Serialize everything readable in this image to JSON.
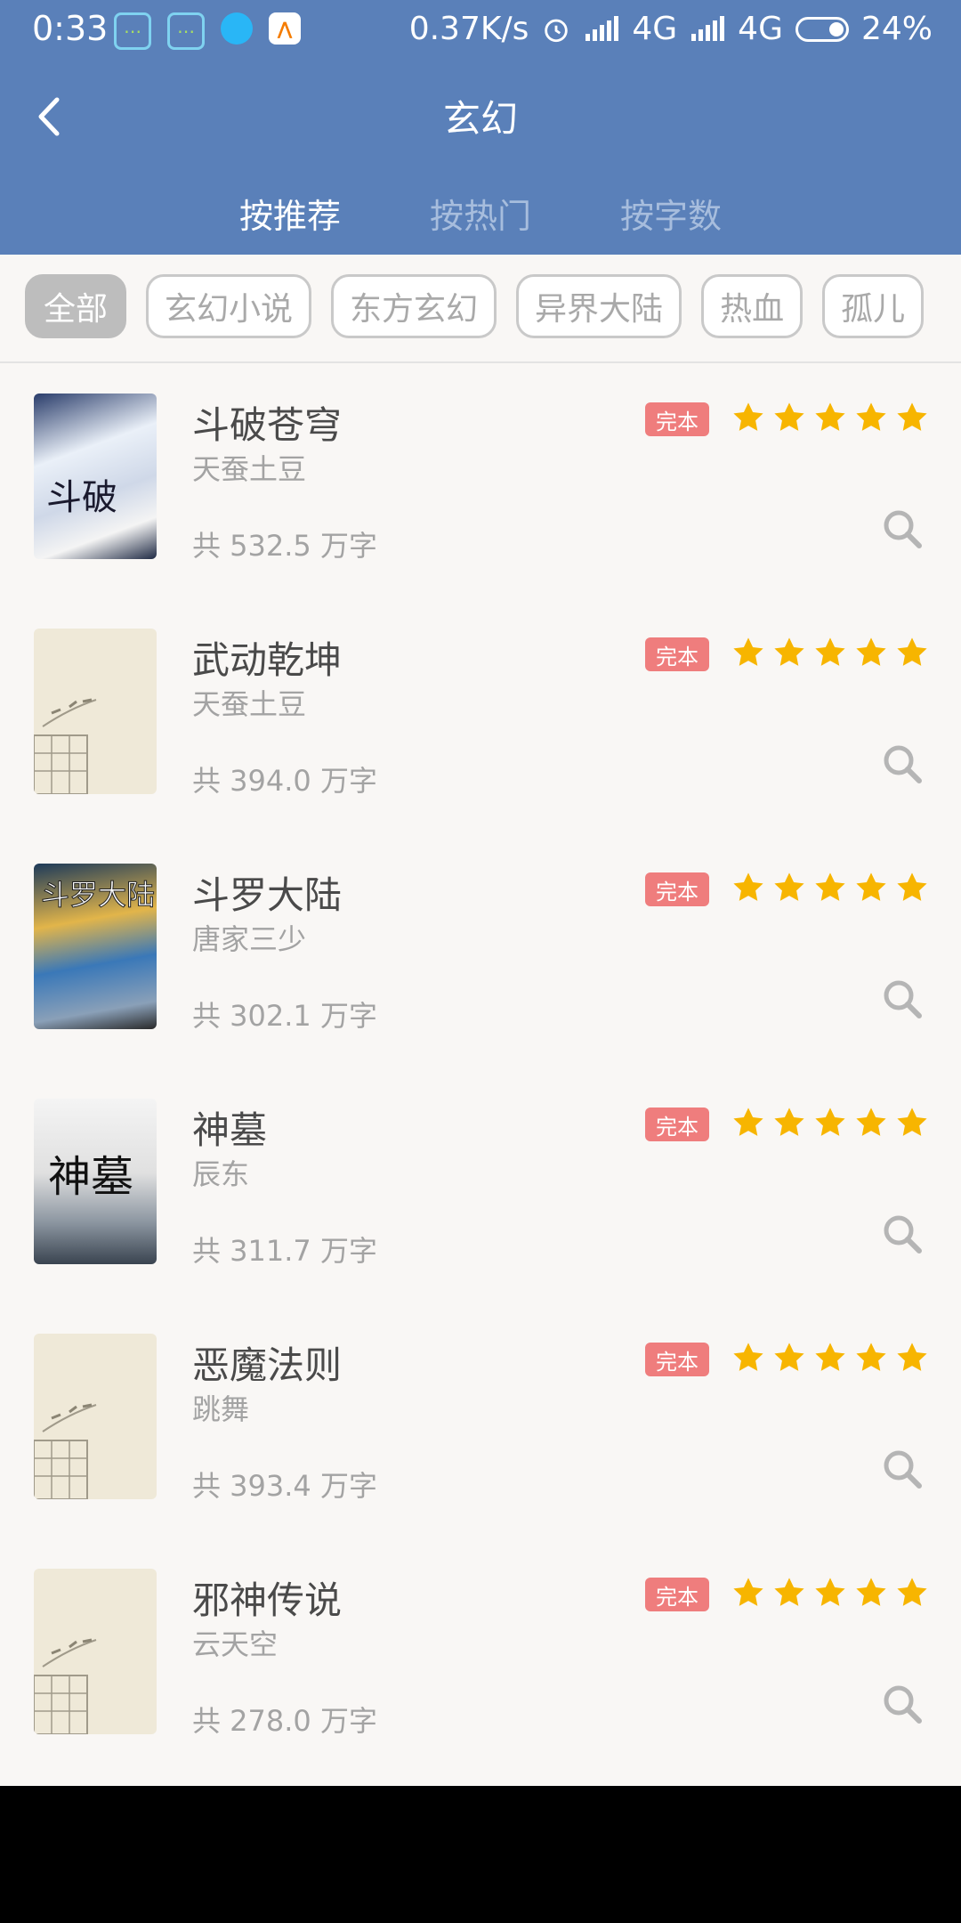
{
  "status_bar": {
    "time": "0:33",
    "network_speed": "0.37K/s",
    "signal_1": "4G",
    "signal_2": "4G",
    "battery": "24%"
  },
  "header": {
    "title": "玄幻",
    "tabs": [
      {
        "label": "按推荐",
        "active": true
      },
      {
        "label": "按热门",
        "active": false
      },
      {
        "label": "按字数",
        "active": false
      }
    ]
  },
  "filters": [
    {
      "label": "全部",
      "active": true
    },
    {
      "label": "玄幻小说",
      "active": false
    },
    {
      "label": "东方玄幻",
      "active": false
    },
    {
      "label": "异界大陆",
      "active": false
    },
    {
      "label": "热血",
      "active": false
    },
    {
      "label": "孤儿",
      "active": false
    }
  ],
  "books": [
    {
      "title": "斗破苍穹",
      "author": "天蚕土豆",
      "words": "共 532.5 万字",
      "badge": "完本",
      "rating": 5,
      "cover": "image"
    },
    {
      "title": "武动乾坤",
      "author": "天蚕土豆",
      "words": "共 394.0 万字",
      "badge": "完本",
      "rating": 5,
      "cover": "placeholder"
    },
    {
      "title": "斗罗大陆",
      "author": "唐家三少",
      "words": "共 302.1 万字",
      "badge": "完本",
      "rating": 5,
      "cover": "image"
    },
    {
      "title": "神墓",
      "author": "辰东",
      "words": "共 311.7 万字",
      "badge": "完本",
      "rating": 5,
      "cover": "image"
    },
    {
      "title": "恶魔法则",
      "author": "跳舞",
      "words": "共 393.4 万字",
      "badge": "完本",
      "rating": 5,
      "cover": "placeholder"
    },
    {
      "title": "邪神传说",
      "author": "云天空",
      "words": "共 278.0 万字",
      "badge": "完本",
      "rating": 5,
      "cover": "placeholder"
    }
  ],
  "colors": {
    "header": "#5a80b9",
    "badge": "#ef7d7d",
    "star": "#f7b500"
  }
}
